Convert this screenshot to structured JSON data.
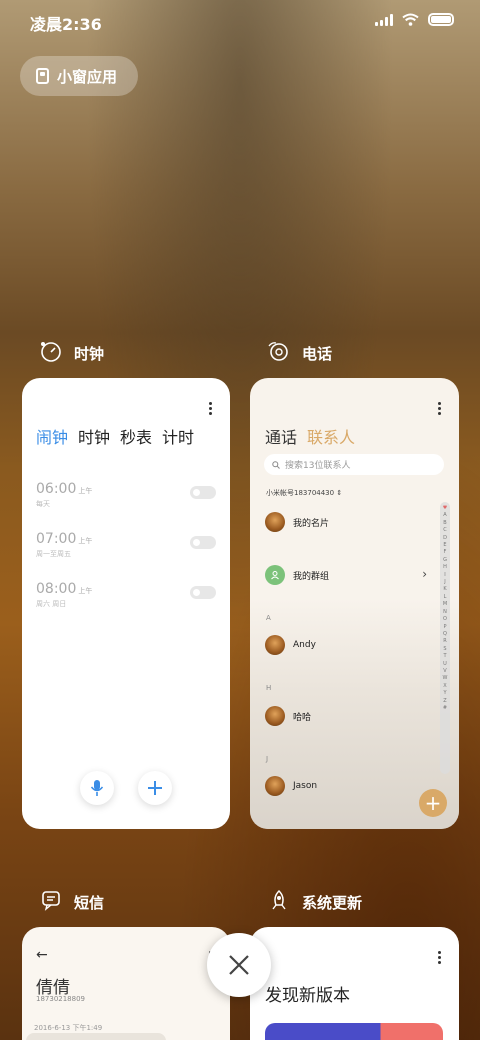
{
  "status_bar": {
    "time": "凌晨2:36",
    "signal_icon": "signal-icon",
    "wifi_icon": "wifi-icon",
    "battery_icon": "battery-icon"
  },
  "small_window": {
    "label": "小窗应用",
    "icon": "small-window-icon"
  },
  "apps": {
    "clock": {
      "name": "时钟",
      "icon": "clock-icon",
      "tabs": [
        "闹钟",
        "时钟",
        "秒表",
        "计时"
      ],
      "active_tab_color": "#3a8de6",
      "alarms": [
        {
          "time": "06:00",
          "ampm": "上午",
          "days": "每天"
        },
        {
          "time": "07:00",
          "ampm": "上午",
          "days": "周一至周五"
        },
        {
          "time": "08:00",
          "ampm": "上午",
          "days": "周六 周日"
        }
      ],
      "mic_icon": "microphone-icon",
      "add_icon": "plus-icon"
    },
    "phone": {
      "name": "电话",
      "icon": "phone-icon",
      "tabs": [
        "通话",
        "联系人"
      ],
      "active_tab_color": "#d9a968",
      "search_placeholder": "搜索13位联系人",
      "mi_account": "小米帐号183704430",
      "my_card": "我的名片",
      "my_groups": "我的群组",
      "sections": [
        {
          "letter": "A",
          "contact": "Andy"
        },
        {
          "letter": "H",
          "contact": "哈哈"
        },
        {
          "letter": "J",
          "contact": "Jason"
        }
      ],
      "index_letters": [
        "A",
        "B",
        "C",
        "D",
        "E",
        "F",
        "G",
        "H",
        "I",
        "J",
        "K",
        "L",
        "M",
        "N",
        "O",
        "P",
        "Q",
        "R",
        "S",
        "T",
        "U",
        "V",
        "W",
        "X",
        "Y",
        "Z",
        "#"
      ]
    },
    "sms": {
      "name": "短信",
      "icon": "message-icon",
      "back_icon": "back-arrow-icon",
      "contact_name": "倩倩",
      "contact_number": "18730218809",
      "date": "2016-6-13 下午1:49"
    },
    "update": {
      "name": "系统更新",
      "icon": "rocket-icon",
      "title": "发现新版本"
    }
  },
  "close_icon": "close-icon"
}
